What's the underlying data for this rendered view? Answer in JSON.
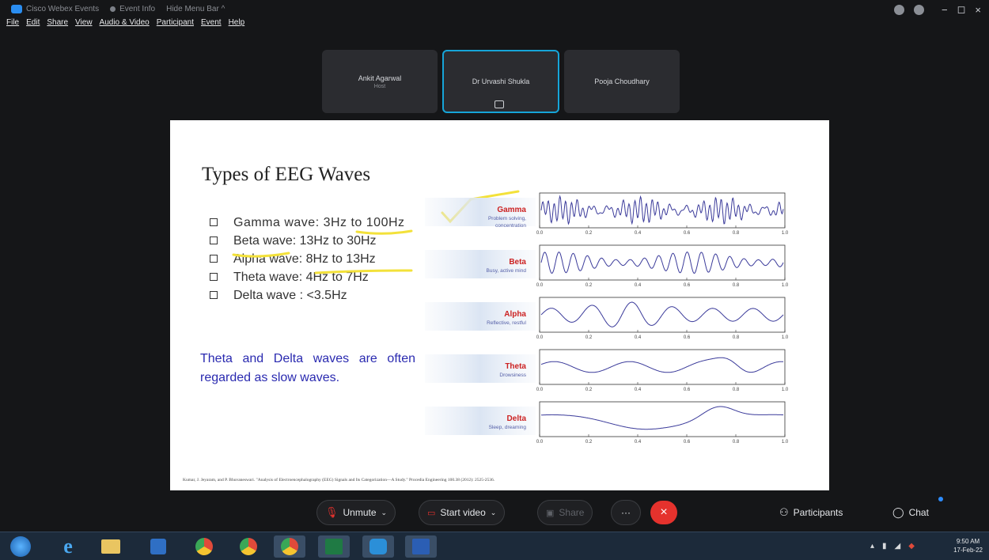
{
  "titlebar": {
    "app_name": "Cisco Webex Events",
    "event_info": "Event Info",
    "hide_menu": "Hide Menu Bar ^"
  },
  "menubar": [
    "File",
    "Edit",
    "Share",
    "View",
    "Audio & Video",
    "Participant",
    "Event",
    "Help"
  ],
  "window_controls": {
    "minimize": "−",
    "restore": "◻",
    "close": "×"
  },
  "participants": [
    {
      "name": "Ankit Agarwal",
      "role": "Host"
    },
    {
      "name": "Dr Urvashi Shukla",
      "role": ""
    },
    {
      "name": "Pooja Choudhary",
      "role": ""
    }
  ],
  "slide": {
    "title": "Types of EEG Waves",
    "bullets": [
      "Gamma wave: 3Hz to 100Hz",
      "Beta wave: 13Hz to 30Hz",
      "Alpha wave: 8Hz to 13Hz",
      "Theta wave: 4Hz to 7Hz",
      "Delta wave : <3.5Hz"
    ],
    "note": "Theta and Delta waves are often regarded as slow waves.",
    "citation": "Kumar, J. Jeyaram, and P. Bhuvaneswari. \"Analysis of Electroencephalography (EEG) Signals and Its Categorization—A Study.\" Procedia Engineering 100.38 (2012): 2525-2536.",
    "figure": {
      "waves": [
        {
          "name": "Gamma",
          "desc": [
            "Problem solving,",
            "concentration"
          ]
        },
        {
          "name": "Beta",
          "desc": [
            "Busy, active mind"
          ]
        },
        {
          "name": "Alpha",
          "desc": [
            "Reflective, restful"
          ]
        },
        {
          "name": "Theta",
          "desc": [
            "Drowsiness"
          ]
        },
        {
          "name": "Delta",
          "desc": [
            "Sleep, dreaming"
          ]
        }
      ],
      "x_ticks": [
        "0.0",
        "0.2",
        "0.4",
        "0.6",
        "0.8",
        "1.0"
      ]
    }
  },
  "toolbar": {
    "unmute": "Unmute",
    "start_video": "Start video",
    "share": "Share",
    "more": "···",
    "end": "×",
    "participants": "Participants",
    "chat": "Chat"
  },
  "taskbar": {
    "time": "9:50 AM",
    "date": "17-Feb-22"
  },
  "colors": {
    "accent": "#16a5d8",
    "end_call": "#e5322d",
    "note_text": "#2a2ab0",
    "wave": "#3a3a9a",
    "wave_label": "#cc2222"
  }
}
